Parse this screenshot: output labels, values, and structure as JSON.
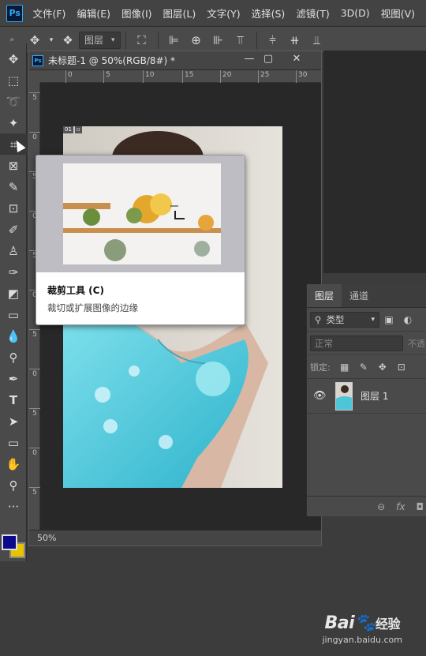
{
  "app": {
    "logo": "Ps"
  },
  "menu": [
    "文件(F)",
    "编辑(E)",
    "图像(I)",
    "图层(L)",
    "文字(Y)",
    "选择(S)",
    "滤镜(T)",
    "3D(D)",
    "视图(V)"
  ],
  "options_bar": {
    "auto_select_value": "图层"
  },
  "document": {
    "title": "未标题-1 @ 50%(RGB/8#) *",
    "zoom": "50%",
    "ruler_h": [
      "0",
      "5",
      "10",
      "15",
      "20",
      "25",
      "30"
    ],
    "ruler_v": [
      "5",
      "0",
      "5",
      "0",
      "5",
      "0",
      "5",
      "0",
      "5",
      "0",
      "5"
    ],
    "layer_badge": "01"
  },
  "tooltip": {
    "title": "裁剪工具 (C)",
    "description": "裁切或扩展图像的边缘"
  },
  "layers_panel": {
    "tabs": [
      "图层",
      "通道"
    ],
    "filter_label": "类型",
    "blend_mode": "正常",
    "opacity_label": "不透",
    "lock_label": "锁定:",
    "layer_name": "图层 1"
  },
  "watermark": {
    "brand_prefix": "Bai",
    "brand_suffix": "经验",
    "url": "jingyan.baidu.com"
  },
  "colors": {
    "foreground": "#0a0a8a",
    "background": "#e8c400",
    "ps_blue": "#31a8ff"
  }
}
